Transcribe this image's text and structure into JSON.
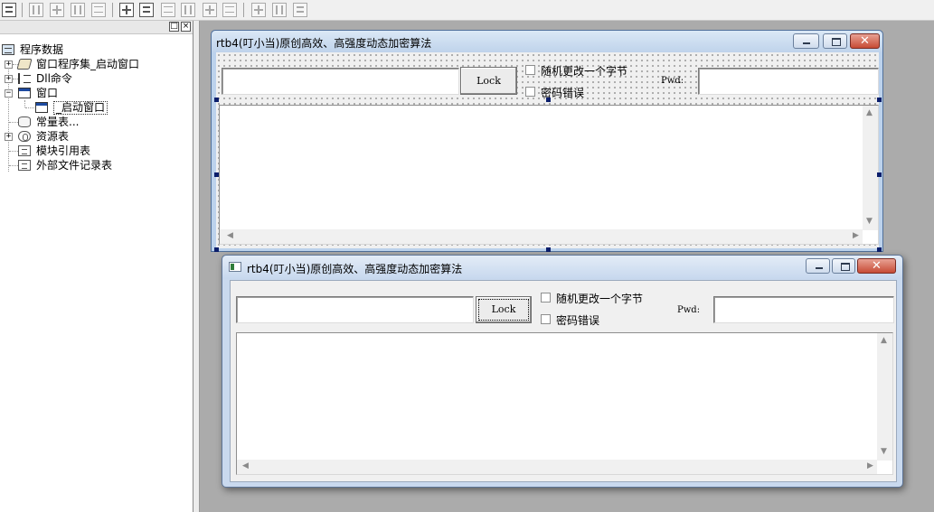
{
  "toolbar": {
    "icons": [
      "align-left-icon",
      "align-hcenter-icon",
      "align-right-icon",
      "align-top-icon",
      "align-vcenter-icon",
      "align-bottom-icon",
      "center-horizontal-icon",
      "center-vertical-icon",
      "space-across-icon",
      "space-down-icon",
      "same-width-icon",
      "same-height-icon",
      "same-size-icon"
    ]
  },
  "tree_panel": {
    "header_buttons": [
      "□",
      "×"
    ],
    "items": [
      {
        "label": "程序数据",
        "icon": "database-icon"
      },
      {
        "label": "窗口程序集_启动窗口",
        "icon": "stack-icon"
      },
      {
        "label": "Dll命令",
        "icon": "dll-icon"
      },
      {
        "label": "窗口",
        "icon": "window-icon"
      },
      {
        "label": "_启动窗口",
        "icon": "window-icon"
      },
      {
        "label": "常量表...",
        "icon": "cylinder-icon"
      },
      {
        "label": "资源表",
        "icon": "resource-icon"
      },
      {
        "label": "模块引用表",
        "icon": "module-icon"
      },
      {
        "label": "外部文件记录表",
        "icon": "file-record-icon"
      }
    ],
    "expanders": [
      "+",
      "+",
      "−",
      "+"
    ]
  },
  "designer_window": {
    "title": "rtb4(叮小当)原创高效、高强度动态加密算法",
    "close_glyph": "✕",
    "lock_label": "Lock",
    "checkbox1_label": "随机更改一个字节",
    "checkbox2_label": "密码错误",
    "pwd_label": "Pwd:",
    "scroll_up": "▲",
    "scroll_down": "▼",
    "scroll_left": "◀",
    "scroll_right": "▶"
  },
  "runtime_window": {
    "title": "rtb4(叮小当)原创高效、高强度动态加密算法",
    "close_glyph": "✕",
    "lock_label": "Lock",
    "checkbox1_label": "随机更改一个字节",
    "checkbox2_label": "密码错误",
    "pwd_label": "Pwd:",
    "scroll_up": "▲",
    "scroll_down": "▼",
    "scroll_left": "◀",
    "scroll_right": "▶"
  },
  "colors": {
    "workspace": "#ababab",
    "title_active": "#bfd3eb",
    "close_button": "#c74b35",
    "selection_handle": "#0b1e6b"
  }
}
